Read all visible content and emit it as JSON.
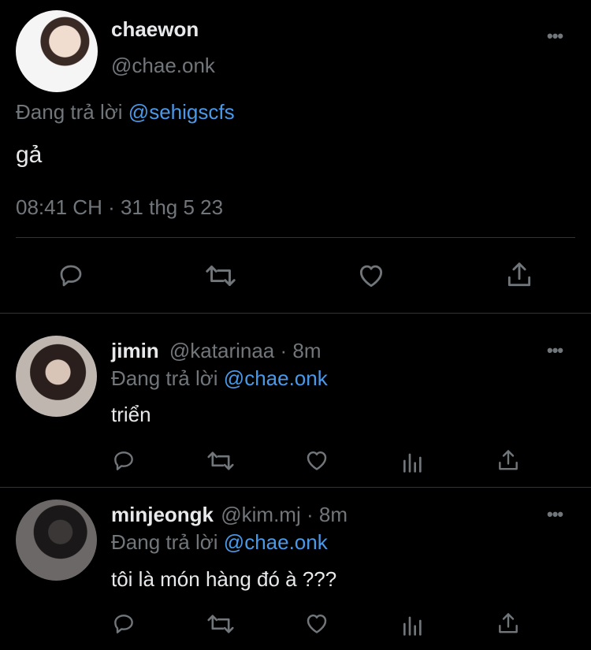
{
  "main_tweet": {
    "display_name": "chaewon",
    "handle": "@chae.onk",
    "reply_prefix": "Đang trả lời",
    "reply_to": "@sehigscfs",
    "text": "gả",
    "timestamp": "08:41 CH · 31 thg 5 23"
  },
  "replies": [
    {
      "display_name": "jimin",
      "handle": "@katarinaa",
      "time": "· 8m",
      "reply_prefix": "Đang trả lời",
      "reply_to": "@chae.onk",
      "text": "triển"
    },
    {
      "display_name": "minjeongk",
      "handle": "@kim.mj",
      "time": "· 8m",
      "reply_prefix": "Đang trả lời",
      "reply_to": "@chae.onk",
      "text": "tôi là món hàng đó à ???"
    }
  ],
  "more_label": "•••",
  "icons": {
    "reply": "reply-icon",
    "retweet": "retweet-icon",
    "like": "like-icon",
    "share": "share-icon",
    "views": "views-icon",
    "more": "more-icon"
  },
  "colors": {
    "background": "#000000",
    "text": "#e7e9ea",
    "muted": "#71767b",
    "link": "#4a99e9",
    "divider": "#2f3336"
  }
}
